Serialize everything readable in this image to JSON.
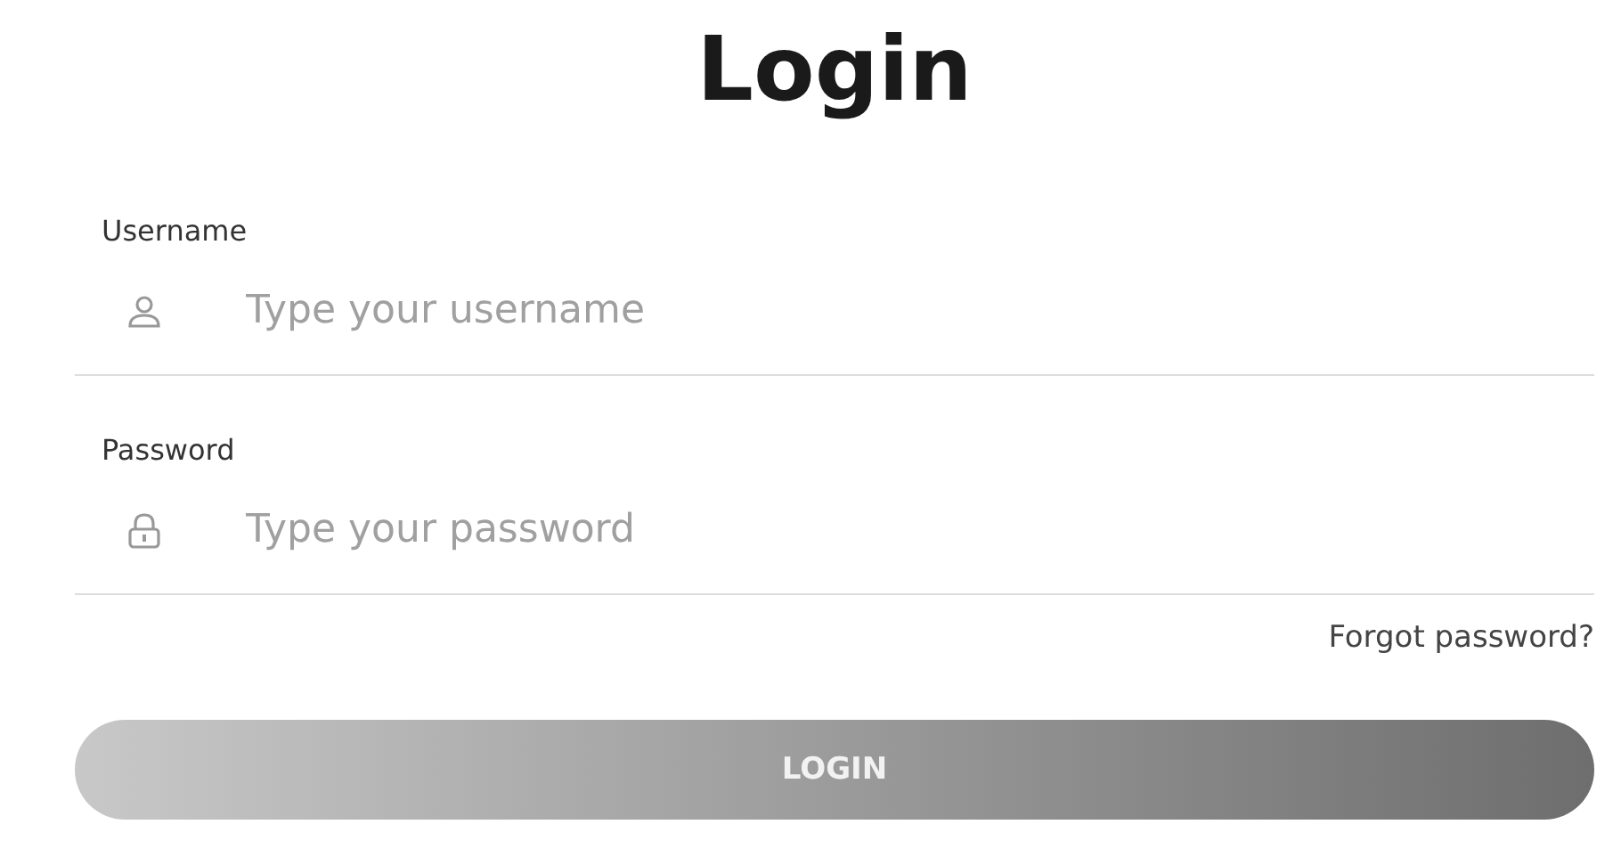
{
  "title": "Login",
  "fields": [
    {
      "label": "Username",
      "placeholder": "Type your username",
      "kind": "user"
    },
    {
      "label": "Password",
      "placeholder": "Type your password",
      "kind": "lock"
    }
  ],
  "forgot_link": "Forgot password?",
  "button": "LOGIN"
}
